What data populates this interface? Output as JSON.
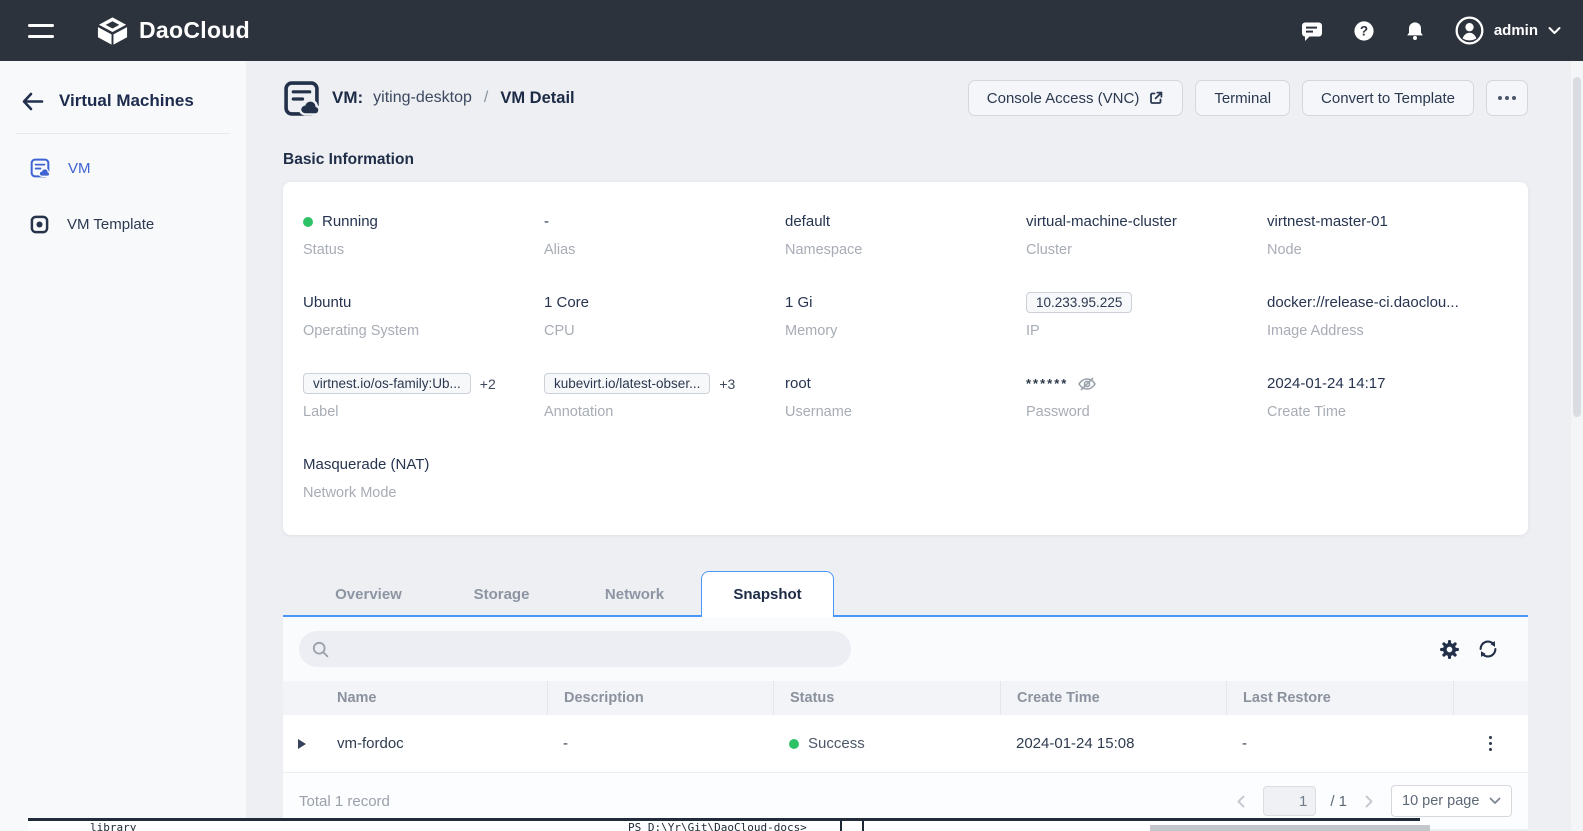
{
  "topbar": {
    "brand": "DaoCloud",
    "user": "admin"
  },
  "sidebar": {
    "title": "Virtual Machines",
    "items": [
      {
        "label": "VM"
      },
      {
        "label": "VM Template"
      }
    ]
  },
  "header": {
    "entity": "VM:",
    "name": "yiting-desktop",
    "sep": "/",
    "page": "VM Detail",
    "actions": {
      "console": "Console Access (VNC)",
      "terminal": "Terminal",
      "convert": "Convert to Template"
    }
  },
  "basic_info": {
    "title": "Basic Information",
    "fields": [
      {
        "value": "Running",
        "label": "Status"
      },
      {
        "value": "-",
        "label": "Alias"
      },
      {
        "value": "default",
        "label": "Namespace"
      },
      {
        "value": "virtual-machine-cluster",
        "label": "Cluster"
      },
      {
        "value": "virtnest-master-01",
        "label": "Node"
      },
      {
        "value": "Ubuntu",
        "label": "Operating System"
      },
      {
        "value": "1 Core",
        "label": "CPU"
      },
      {
        "value": "1 Gi",
        "label": "Memory"
      },
      {
        "value": "10.233.95.225",
        "label": "IP"
      },
      {
        "value": "docker://release-ci.daoclou...",
        "label": "Image Address"
      },
      {
        "value": "virtnest.io/os-family:Ub...",
        "extra": "+2",
        "label": "Label"
      },
      {
        "value": "kubevirt.io/latest-obser...",
        "extra": "+3",
        "label": "Annotation"
      },
      {
        "value": "root",
        "label": "Username"
      },
      {
        "value": "******",
        "label": "Password"
      },
      {
        "value": "2024-01-24 14:17",
        "label": "Create Time"
      },
      {
        "value": "Masquerade (NAT)",
        "label": "Network Mode"
      }
    ]
  },
  "tabs": [
    {
      "label": "Overview"
    },
    {
      "label": "Storage"
    },
    {
      "label": "Network"
    },
    {
      "label": "Snapshot"
    }
  ],
  "snapshot_panel": {
    "search_placeholder": "",
    "table": {
      "columns": [
        "Name",
        "Description",
        "Status",
        "Create Time",
        "Last Restore"
      ],
      "rows": [
        {
          "name": "vm-fordoc",
          "description": "-",
          "status": "Success",
          "create_time": "2024-01-24 15:08",
          "last_restore": "-"
        }
      ]
    },
    "footer": {
      "total": "Total 1 record",
      "page_current": "1",
      "page_total": "/ 1",
      "page_size": "10 per page"
    }
  },
  "colors": {
    "navbar": "#2d333c",
    "tab_accent_blue": "#4a97f7",
    "sidebar_active_blue": "#3f63d2",
    "status_green": "#2ec267"
  },
  "artifact": {
    "left_text": "library",
    "path_text": "PS D:\\Yr\\Git\\DaoCloud-docs>"
  }
}
